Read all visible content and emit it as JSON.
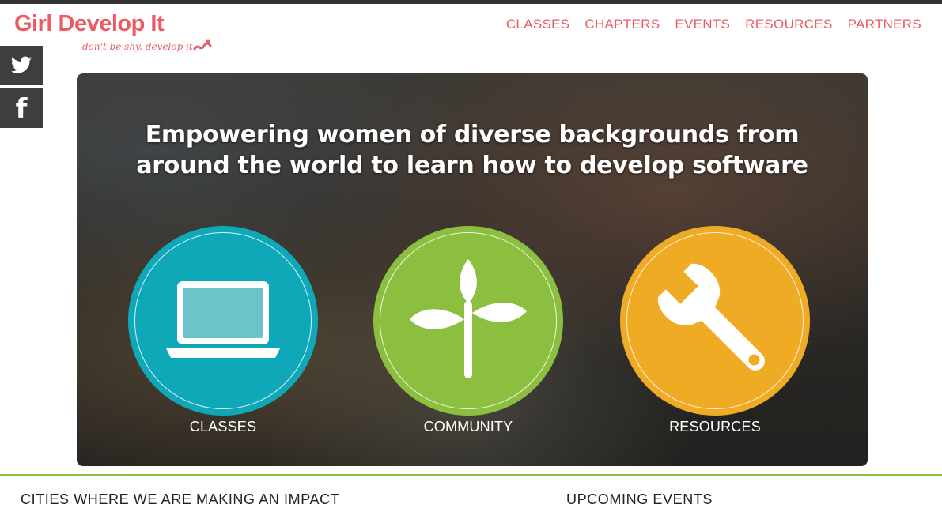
{
  "logo": {
    "title": "Girl Develop It",
    "tagline": "don't be shy. develop it."
  },
  "nav": {
    "items": [
      {
        "label": "CLASSES"
      },
      {
        "label": "CHAPTERS"
      },
      {
        "label": "EVENTS"
      },
      {
        "label": "RESOURCES"
      },
      {
        "label": "PARTNERS"
      }
    ]
  },
  "social": [
    {
      "icon": "twitter-icon"
    },
    {
      "icon": "facebook-icon",
      "glyph": "f"
    }
  ],
  "hero": {
    "heading_line1": "Empowering women of diverse backgrounds from",
    "heading_line2": "around the world to learn how to develop software",
    "features": [
      {
        "label": "CLASSES",
        "icon": "laptop-icon",
        "color": "#0fa8b8"
      },
      {
        "label": "COMMUNITY",
        "icon": "sprout-icon",
        "color": "#8cbf3f"
      },
      {
        "label": "RESOURCES",
        "icon": "wrench-icon",
        "color": "#f0ab25"
      }
    ]
  },
  "sections": {
    "cities_title": "CITIES WHERE WE ARE MAKING AN IMPACT",
    "events_title": "UPCOMING EVENTS"
  },
  "colors": {
    "brand": "#ec5a63",
    "accent_green": "#8cbf3f",
    "topbar": "#333333",
    "social_bg": "#3e3e3e"
  }
}
